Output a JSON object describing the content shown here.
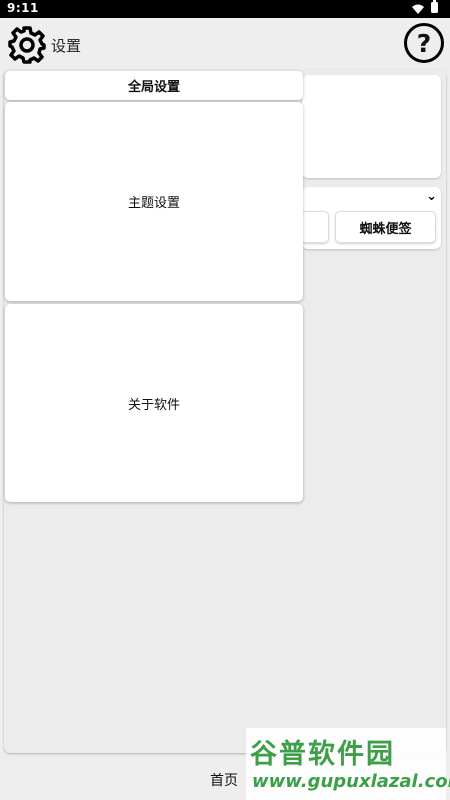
{
  "status_bar": {
    "time": "9:11",
    "wifi_icon": "wifi-icon",
    "battery_icon": "battery-icon"
  },
  "app_bar": {
    "title": "设置",
    "settings_icon": "gear-icon",
    "help_icon": "help-icon",
    "help_glyph": "?"
  },
  "menu": {
    "global": "全局设置",
    "theme": "主题设置",
    "about": "关于软件"
  },
  "tools_card": {
    "chevron": "⌄",
    "button_label": "蜘蛛便签"
  },
  "bottom_nav": {
    "home": "首页"
  },
  "watermark": {
    "brand": "谷普软件园",
    "url": "www.gupuxlazal.com"
  },
  "colors": {
    "background": "#eeeeee",
    "card": "#ffffff",
    "watermark": "#2f9a3c"
  }
}
